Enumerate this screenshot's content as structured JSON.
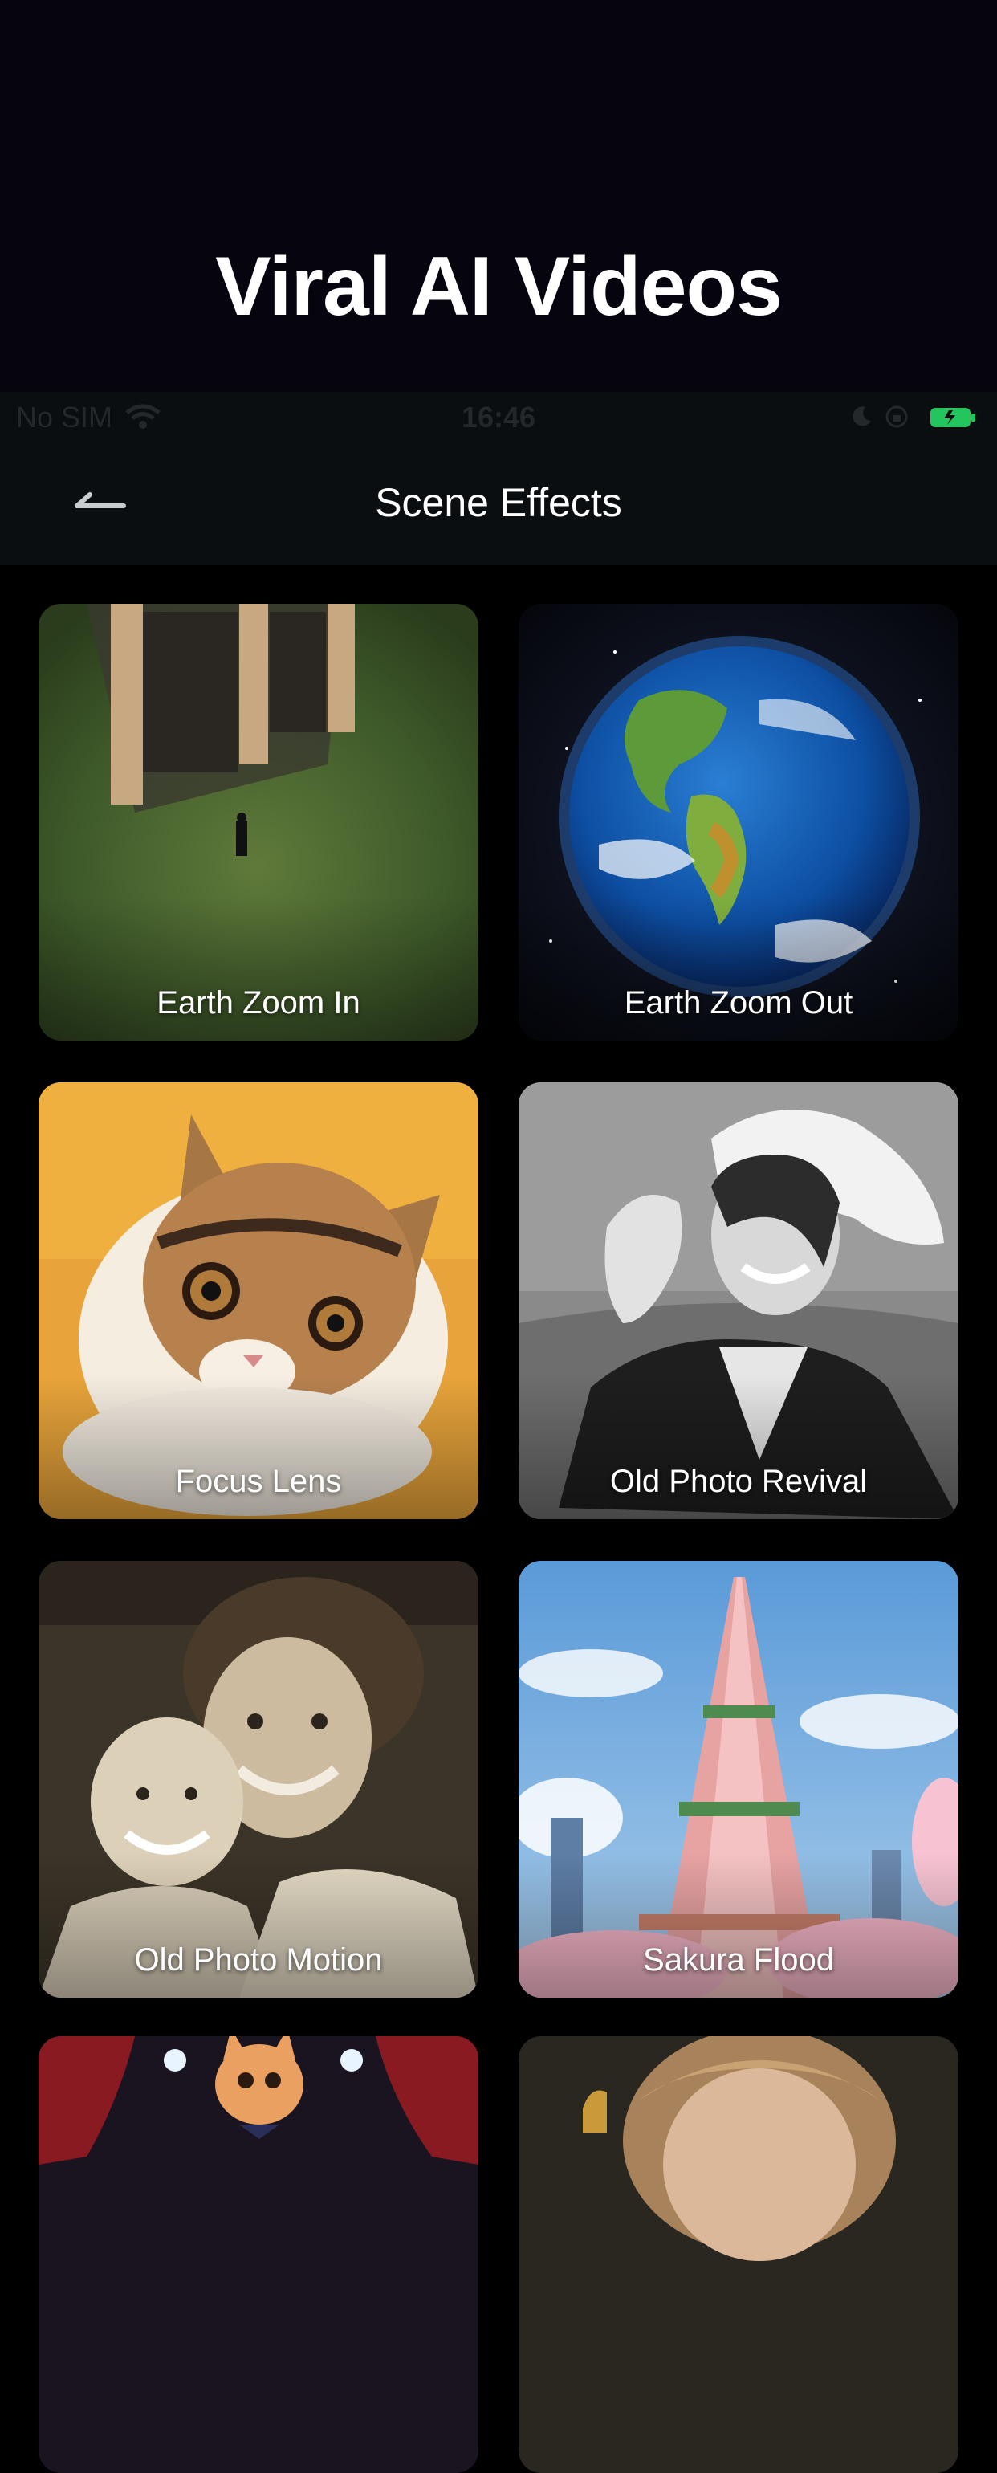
{
  "banner": {
    "title": "Viral AI Videos"
  },
  "status_bar": {
    "carrier": "No SIM",
    "time": "16:46",
    "icons": [
      "wifi-icon",
      "moon-icon",
      "orientation-lock-icon",
      "battery-icon"
    ],
    "battery_color": "#22c55e"
  },
  "nav": {
    "title": "Scene Effects",
    "back_icon": "back-arrow-icon"
  },
  "effects": [
    {
      "label": "Earth Zoom In"
    },
    {
      "label": "Earth Zoom Out"
    },
    {
      "label": "Focus Lens"
    },
    {
      "label": "Old Photo Revival"
    },
    {
      "label": "Old Photo Motion"
    },
    {
      "label": "Sakura Flood"
    },
    {
      "label": ""
    },
    {
      "label": ""
    }
  ]
}
